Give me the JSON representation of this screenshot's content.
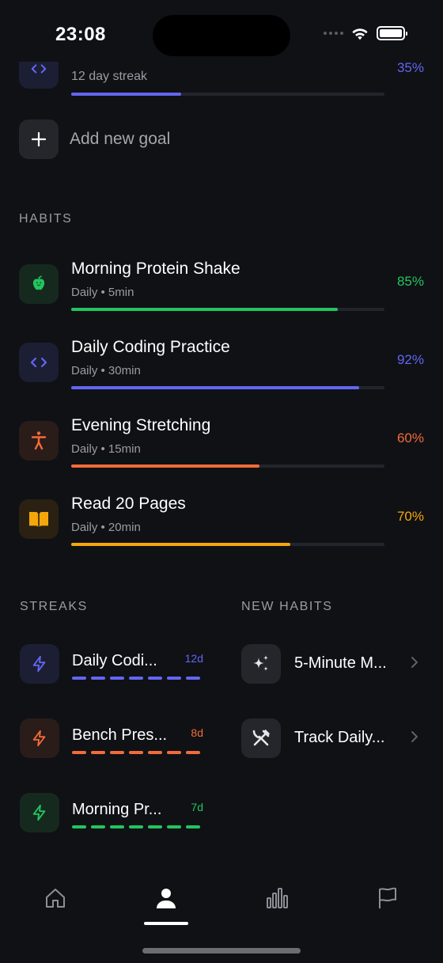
{
  "status_bar": {
    "time": "23:08"
  },
  "partial_goal": {
    "subtitle": "12 day streak",
    "percent": "35%",
    "progress": 0.35,
    "icon": "code-icon",
    "color": "#6366f1"
  },
  "add_goal": {
    "label": "Add new goal"
  },
  "sections": {
    "habits": "HABITS",
    "streaks": "STREAKS",
    "new_habits": "NEW HABITS"
  },
  "habits": [
    {
      "title": "Morning Protein Shake",
      "subtitle": "Daily • 5min",
      "percent": "85%",
      "progress": 0.85,
      "color": "#22c55e",
      "icon": "apple-icon"
    },
    {
      "title": "Daily Coding Practice",
      "subtitle": "Daily • 30min",
      "percent": "92%",
      "progress": 0.92,
      "color": "#6366f1",
      "icon": "code-icon"
    },
    {
      "title": "Evening Stretching",
      "subtitle": "Daily • 15min",
      "percent": "60%",
      "progress": 0.6,
      "color": "#f26b3a",
      "icon": "person-stretch-icon"
    },
    {
      "title": "Read 20 Pages",
      "subtitle": "Daily • 20min",
      "percent": "70%",
      "progress": 0.7,
      "color": "#f5a70a",
      "icon": "book-icon"
    }
  ],
  "streaks": [
    {
      "name": "Daily Codi...",
      "days": "12d",
      "color": "#6366f1",
      "icon": "lightning-icon"
    },
    {
      "name": "Bench Pres...",
      "days": "8d",
      "color": "#f26b3a",
      "icon": "lightning-icon"
    },
    {
      "name": "Morning Pr...",
      "days": "7d",
      "color": "#22c55e",
      "icon": "lightning-icon"
    }
  ],
  "new_habits": [
    {
      "name": "5-Minute M...",
      "icon": "sparkles-icon"
    },
    {
      "name": "Track Daily...",
      "icon": "utensils-icon"
    }
  ],
  "tabs": [
    {
      "name": "home",
      "icon": "home-icon",
      "active": false
    },
    {
      "name": "profile",
      "icon": "person-icon",
      "active": true
    },
    {
      "name": "stats",
      "icon": "bar-chart-icon",
      "active": false
    },
    {
      "name": "goals",
      "icon": "flag-icon",
      "active": false
    }
  ]
}
